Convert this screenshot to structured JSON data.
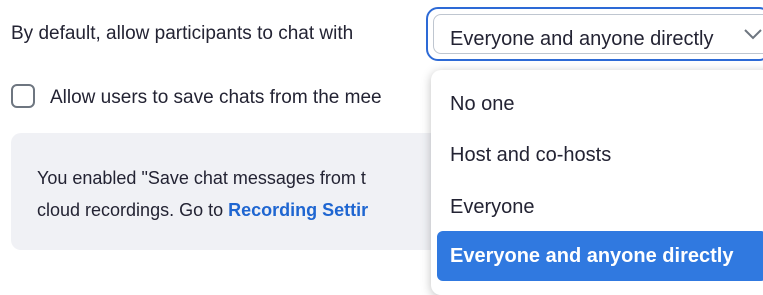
{
  "chat_setting": {
    "label": "By default, allow participants to chat with",
    "selected": "Everyone and anyone directly",
    "options": [
      "No one",
      "Host and co-hosts",
      "Everyone",
      "Everyone and anyone directly"
    ]
  },
  "save_chats": {
    "label": "Allow users to save chats from the mee",
    "checked": false
  },
  "notice": {
    "line1": "You enabled \"Save chat messages from t",
    "line2_prefix": "cloud recordings. Go to ",
    "line2_link": "Recording Settir"
  },
  "colors": {
    "accent": "#2d6ad6",
    "selected_option_bg": "#3079e0",
    "link": "#1f66d1",
    "notice_bg": "#f0f1f5"
  }
}
